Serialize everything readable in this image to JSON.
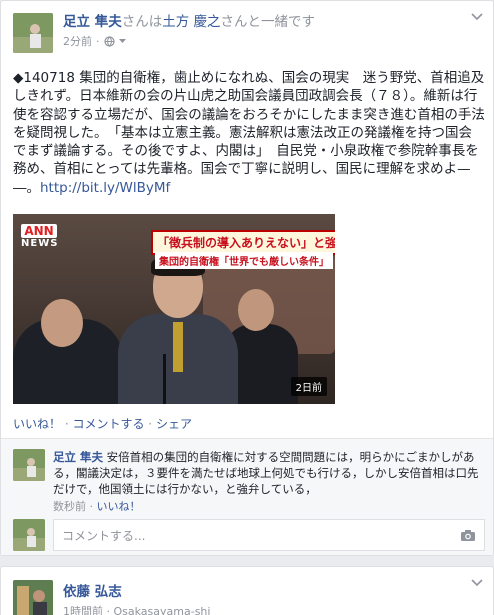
{
  "post": {
    "author": "足立 隼夫",
    "with_prefix": "さんは",
    "with_name": "土方 慶之",
    "with_suffix": "さんと一緒です",
    "time": "2分前",
    "separator": "·",
    "text": "◆140718 集団的自衛権，歯止めになれぬ、国会の現実　迷う野党、首相追及しきれず。日本維新の会の片山虎之助国会議員団政調会長（７８）。維新は行使を容認する立場だが、国会の議論をおろそかにしたまま突き進む首相の手法を疑問視した。　「基本は立憲主義。憲法解釈は憲法改正の発議権を持つ国会でまず議論する。その後ですよ、内閣は」　自民党・小泉政権で参院幹事長を務め、首相にとっては先輩格。国会で丁寧に説明し、国民に理解を求めよ—―。",
    "link": "http://bit.ly/WlByMf",
    "image": {
      "logo_top": "ANN",
      "logo_bottom": "NEWS",
      "caption_main": "「徴兵制の導入ありえない」と強調",
      "caption_sub": "集団的自衛権「世界でも厳しい条件」",
      "ago": "2日前"
    },
    "actions": {
      "like": "いいね！",
      "sep1": " · ",
      "comment": "コメントする",
      "sep2": " · ",
      "share": "シェア"
    }
  },
  "comment": {
    "author": "足立 隼夫",
    "text": "安倍首相の集団的自衛権に対する空間問題には，明らかにごまかしがある，閣議決定は，３要件を満たせば地球上何処でも行ける，しかし安倍首相は口先だけで，他国領土には行かない，と強弁している，",
    "time": "数秒前",
    "sep": " · ",
    "like": "いいね！"
  },
  "comment_input": {
    "placeholder": "コメントする..."
  },
  "post2": {
    "author": "依藤 弘志",
    "time": "1時間前",
    "sep": " · ",
    "location": "Osakasayama-shi"
  },
  "colors": {
    "link": "#365899",
    "meta": "#90949c",
    "background": "#e9ebee"
  },
  "icons": [
    "chevron-down-icon",
    "globe-icon",
    "camera-icon"
  ]
}
